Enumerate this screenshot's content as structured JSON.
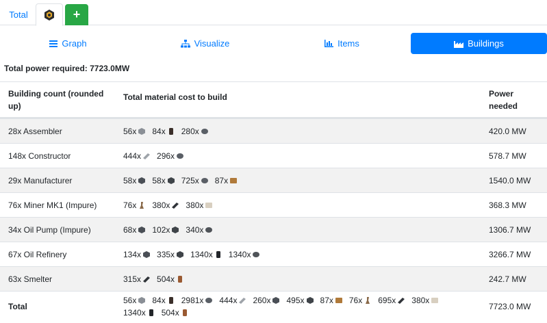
{
  "top_tabs": {
    "total_label": "Total",
    "add_label": "+"
  },
  "nav": {
    "graph_label": "Graph",
    "visualize_label": "Visualize",
    "items_label": "Items",
    "buildings_label": "Buildings"
  },
  "summary": {
    "total_power": "Total power required: 7723.0MW"
  },
  "table": {
    "headers": {
      "building": "Building count (rounded up)",
      "materials": "Total material cost to build",
      "power": "Power needed"
    },
    "rows": [
      {
        "building": "28x Assembler",
        "materials": [
          {
            "qty": "56x",
            "icon": "reinforced-plate-icon",
            "color": "#8a8f96"
          },
          {
            "qty": "84x",
            "icon": "rotor-icon",
            "color": "#3b2f2a"
          },
          {
            "qty": "280x",
            "icon": "screw-icon",
            "color": "#5a5f66"
          }
        ],
        "power": "420.0 MW"
      },
      {
        "building": "148x Constructor",
        "materials": [
          {
            "qty": "444x",
            "icon": "iron-plate-icon",
            "color": "#9ea3a9"
          },
          {
            "qty": "296x",
            "icon": "screw-icon",
            "color": "#5a5f66"
          }
        ],
        "power": "578.7 MW"
      },
      {
        "building": "29x Manufacturer",
        "materials": [
          {
            "qty": "58x",
            "icon": "motor-icon",
            "color": "#4a4f56"
          },
          {
            "qty": "58x",
            "icon": "heavy-frame-icon",
            "color": "#3f4449"
          },
          {
            "qty": "725x",
            "icon": "screw-icon",
            "color": "#5a5f66"
          },
          {
            "qty": "87x",
            "icon": "computer-icon",
            "color": "#b07a3a"
          }
        ],
        "power": "1540.0 MW"
      },
      {
        "building": "76x Miner MK1 (Impure)",
        "materials": [
          {
            "qty": "76x",
            "icon": "portable-miner-icon",
            "color": "#8a6a4a"
          },
          {
            "qty": "380x",
            "icon": "iron-rod-icon",
            "color": "#2f3338"
          },
          {
            "qty": "380x",
            "icon": "concrete-icon",
            "color": "#d8cfc0"
          }
        ],
        "power": "368.3 MW"
      },
      {
        "building": "34x Oil Pump (Impure)",
        "materials": [
          {
            "qty": "68x",
            "icon": "motor-icon",
            "color": "#4a4f56"
          },
          {
            "qty": "102x",
            "icon": "encased-beam-icon",
            "color": "#3f4449"
          },
          {
            "qty": "340x",
            "icon": "cable-icon",
            "color": "#4f5358"
          }
        ],
        "power": "1306.7 MW"
      },
      {
        "building": "67x Oil Refinery",
        "materials": [
          {
            "qty": "134x",
            "icon": "motor-icon",
            "color": "#4a4f56"
          },
          {
            "qty": "335x",
            "icon": "encased-beam-icon",
            "color": "#3f4449"
          },
          {
            "qty": "1340x",
            "icon": "steel-pipe-icon",
            "color": "#23262a"
          },
          {
            "qty": "1340x",
            "icon": "copper-sheet-icon",
            "color": "#4f5358"
          }
        ],
        "power": "3266.7 MW"
      },
      {
        "building": "63x Smelter",
        "materials": [
          {
            "qty": "315x",
            "icon": "iron-rod-icon",
            "color": "#2f3338"
          },
          {
            "qty": "504x",
            "icon": "wire-icon",
            "color": "#9a5a32"
          }
        ],
        "power": "242.7 MW"
      }
    ],
    "total": {
      "label": "Total",
      "materials": [
        {
          "qty": "56x",
          "icon": "reinforced-plate-icon",
          "color": "#8a8f96"
        },
        {
          "qty": "84x",
          "icon": "rotor-icon",
          "color": "#3b2f2a"
        },
        {
          "qty": "2981x",
          "icon": "screw-icon",
          "color": "#5a5f66"
        },
        {
          "qty": "444x",
          "icon": "iron-plate-icon",
          "color": "#9ea3a9"
        },
        {
          "qty": "260x",
          "icon": "motor-icon",
          "color": "#4a4f56"
        },
        {
          "qty": "495x",
          "icon": "encased-beam-icon",
          "color": "#3f4449"
        },
        {
          "qty": "87x",
          "icon": "computer-icon",
          "color": "#b07a3a"
        },
        {
          "qty": "76x",
          "icon": "portable-miner-icon",
          "color": "#8a6a4a"
        },
        {
          "qty": "695x",
          "icon": "iron-rod-icon",
          "color": "#2f3338"
        },
        {
          "qty": "380x",
          "icon": "concrete-icon",
          "color": "#d8cfc0"
        },
        {
          "qty": "1340x",
          "icon": "steel-pipe-icon",
          "color": "#23262a"
        },
        {
          "qty": "504x",
          "icon": "wire-icon",
          "color": "#9a5a32"
        }
      ],
      "power": "7723.0 MW"
    }
  },
  "colors": {
    "accent": "#007bff",
    "add": "#28a745",
    "stripe": "#f2f2f2",
    "border": "#dee2e6"
  }
}
